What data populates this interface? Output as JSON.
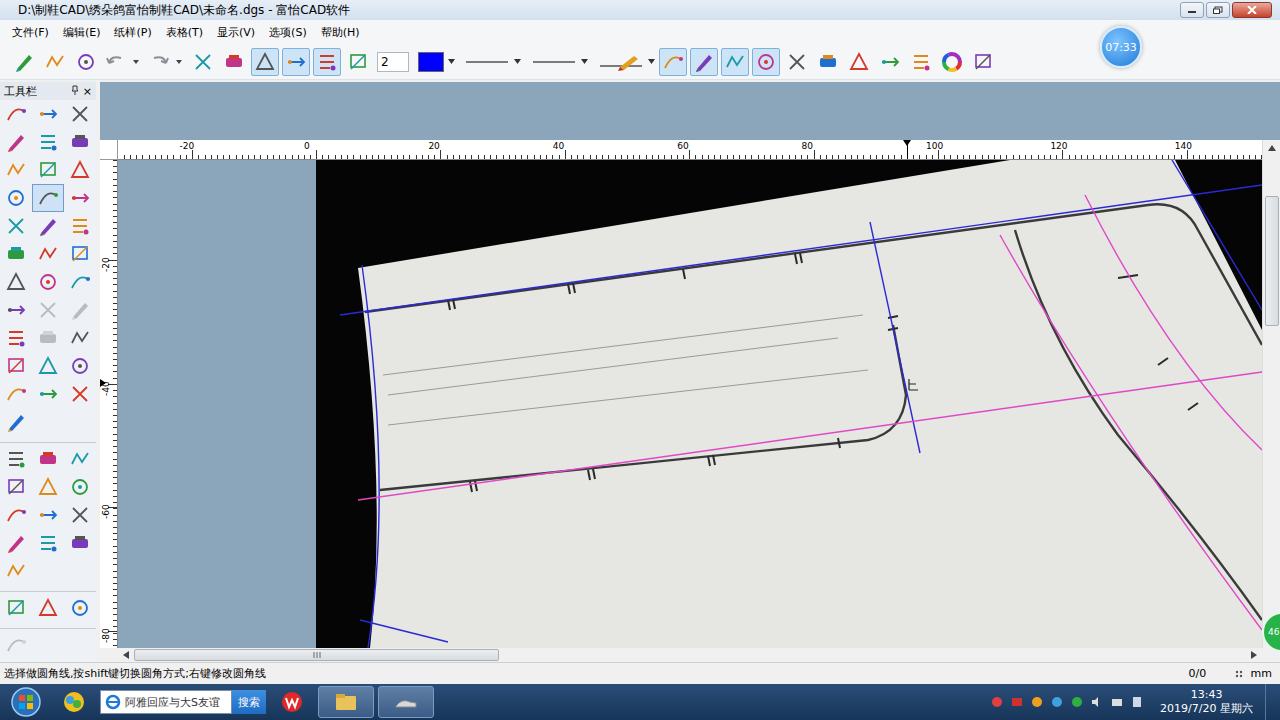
{
  "window": {
    "title": "D:\\制鞋CAD\\绣朵鸽富怡制鞋CAD\\未命名.dgs - 富怡CAD软件"
  },
  "menu": [
    "文件(F)",
    "编辑(E)",
    "纸样(P)",
    "表格(T)",
    "显示(V)",
    "选项(S)",
    "帮助(H)"
  ],
  "timer": "07:33",
  "toolbar": {
    "items": [
      {
        "kind": "icon",
        "selected": false
      },
      {
        "kind": "icon",
        "selected": false
      },
      {
        "kind": "icon",
        "selected": false
      },
      {
        "kind": "arrow",
        "selected": false
      },
      {
        "kind": "arrow",
        "selected": false
      },
      {
        "kind": "icon",
        "selected": false
      },
      {
        "kind": "icon",
        "selected": false
      },
      {
        "kind": "icon",
        "selected": true
      },
      {
        "kind": "icon",
        "selected": true
      },
      {
        "kind": "icon",
        "selected": true
      },
      {
        "kind": "icon",
        "selected": false
      },
      {
        "kind": "field",
        "value": "2"
      },
      {
        "kind": "color",
        "color": "#0000ff"
      },
      {
        "kind": "line",
        "selected": false
      },
      {
        "kind": "line",
        "selected": false
      },
      {
        "kind": "pen",
        "selected": false
      },
      {
        "kind": "icon",
        "selected": true
      },
      {
        "kind": "icon",
        "selected": true
      },
      {
        "kind": "icon",
        "selected": true
      },
      {
        "kind": "icon",
        "selected": true
      },
      {
        "kind": "icon",
        "selected": false
      },
      {
        "kind": "icon",
        "selected": false
      },
      {
        "kind": "icon",
        "selected": false
      },
      {
        "kind": "icon",
        "selected": false
      },
      {
        "kind": "icon",
        "selected": false
      },
      {
        "kind": "wheel",
        "selected": false
      },
      {
        "kind": "icon",
        "selected": false
      }
    ]
  },
  "toolbox": {
    "title": "工具栏",
    "close": "×",
    "groups": [
      {
        "tools": [
          {
            "selected": false,
            "disabled": false
          },
          {
            "selected": false,
            "disabled": false
          },
          {
            "selected": false,
            "disabled": false
          },
          {
            "selected": false,
            "disabled": false
          },
          {
            "selected": false,
            "disabled": false
          },
          {
            "selected": false,
            "disabled": false
          },
          {
            "selected": false,
            "disabled": false
          },
          {
            "selected": false,
            "disabled": false
          },
          {
            "selected": false,
            "disabled": false
          },
          {
            "selected": false,
            "disabled": false
          },
          {
            "selected": true,
            "disabled": false
          },
          {
            "selected": false,
            "disabled": false
          },
          {
            "selected": false,
            "disabled": false
          },
          {
            "selected": false,
            "disabled": false
          },
          {
            "selected": false,
            "disabled": false
          },
          {
            "selected": false,
            "disabled": false
          },
          {
            "selected": false,
            "disabled": false
          },
          {
            "selected": false,
            "disabled": false
          },
          {
            "selected": false,
            "disabled": false
          },
          {
            "selected": false,
            "disabled": false
          },
          {
            "selected": false,
            "disabled": false
          },
          {
            "selected": false,
            "disabled": false
          },
          {
            "selected": false,
            "disabled": true
          },
          {
            "selected": false,
            "disabled": true
          },
          {
            "selected": false,
            "disabled": false
          },
          {
            "selected": false,
            "disabled": true
          },
          {
            "selected": false,
            "disabled": false
          },
          {
            "selected": false,
            "disabled": false
          },
          {
            "selected": false,
            "disabled": false
          },
          {
            "selected": false,
            "disabled": false
          },
          {
            "selected": false,
            "disabled": false
          },
          {
            "selected": false,
            "disabled": false
          },
          {
            "selected": false,
            "disabled": false
          },
          {
            "selected": false,
            "disabled": false
          }
        ]
      },
      {
        "tools": [
          {
            "selected": false,
            "disabled": false
          },
          {
            "selected": false,
            "disabled": false
          },
          {
            "selected": false,
            "disabled": false
          },
          {
            "selected": false,
            "disabled": false
          },
          {
            "selected": false,
            "disabled": false
          },
          {
            "selected": false,
            "disabled": false
          },
          {
            "selected": false,
            "disabled": false
          },
          {
            "selected": false,
            "disabled": false
          },
          {
            "selected": false,
            "disabled": false
          },
          {
            "selected": false,
            "disabled": false
          },
          {
            "selected": false,
            "disabled": false
          },
          {
            "selected": false,
            "disabled": false
          },
          {
            "selected": false,
            "disabled": false
          }
        ]
      },
      {
        "tools": [
          {
            "selected": false,
            "disabled": false
          },
          {
            "selected": false,
            "disabled": false
          },
          {
            "selected": false,
            "disabled": false
          }
        ]
      },
      {
        "tools": [
          {
            "selected": false,
            "disabled": true
          }
        ]
      }
    ]
  },
  "rulers": {
    "horizontal": [
      "-20",
      "0",
      "20",
      "40",
      "60",
      "80",
      "100",
      "120",
      "140"
    ],
    "vertical": [
      "-20",
      "-40",
      "-60",
      "-80"
    ]
  },
  "canvas": {
    "guides": [
      {
        "color": "#2a2ad6"
      },
      {
        "color": "#2a2ad6"
      },
      {
        "color": "#2a2ad6"
      },
      {
        "color": "#2a2ad6"
      },
      {
        "color": "#2a2ad6"
      },
      {
        "color": "#e048c8"
      },
      {
        "color": "#e048c8"
      },
      {
        "color": "#e048c8"
      }
    ]
  },
  "side_badge": "46",
  "status_bar": {
    "hint": "选择做圆角线,按shift键切换圆角方式;右键修改圆角线",
    "count": "0/0",
    "unit": "mm"
  },
  "taskbar": {
    "search_text": "阿雅回应与大S友谊",
    "search_button": "搜索",
    "time": "13:43",
    "date": "2019/7/20 星期六",
    "apps": [
      {
        "selected": false
      },
      {
        "selected": false
      },
      {
        "selected": true
      },
      {
        "selected": true
      }
    ]
  }
}
